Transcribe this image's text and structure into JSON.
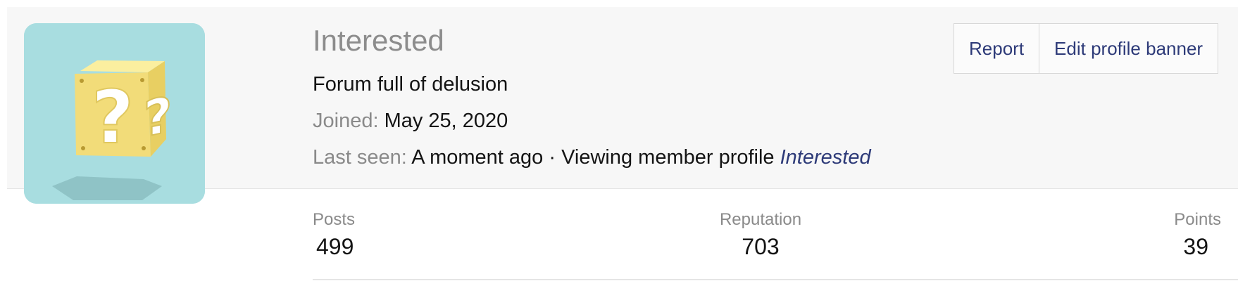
{
  "profile": {
    "username": "Interested",
    "custom_title": "Forum full of delusion",
    "joined_label": "Joined:",
    "joined_value": "May 25, 2020",
    "last_seen_label": "Last seen:",
    "last_seen_value": "A moment ago · Viewing member profile",
    "last_seen_link": "Interested"
  },
  "actions": {
    "report_label": "Report",
    "edit_banner_label": "Edit profile banner"
  },
  "stats": {
    "posts_label": "Posts",
    "posts_value": "499",
    "reputation_label": "Reputation",
    "reputation_value": "703",
    "points_label": "Points",
    "points_value": "39"
  },
  "colors": {
    "link": "#2d3a78",
    "avatar_bg": "#a8dde0",
    "block_yellow": "#f4df7a",
    "muted_text": "#8a8a8a"
  },
  "avatar": {
    "icon": "question-block-icon"
  }
}
